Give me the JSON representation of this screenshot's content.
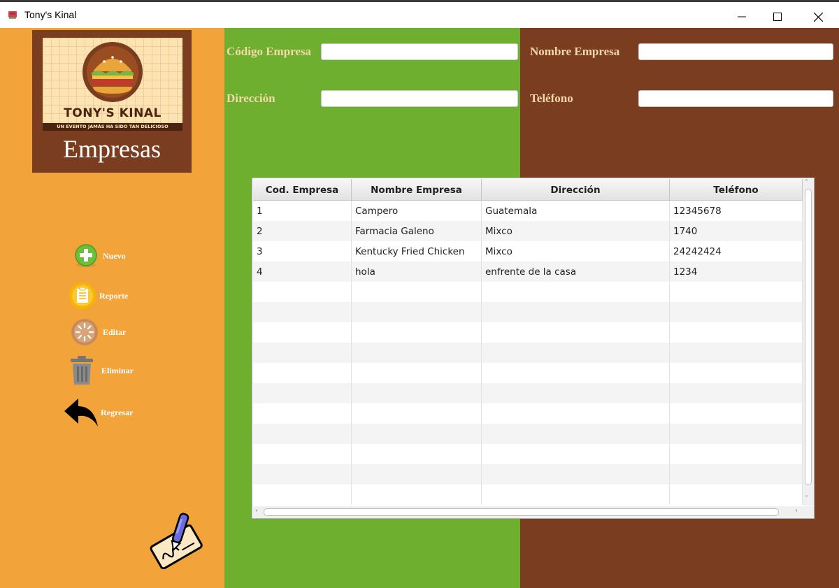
{
  "window": {
    "title": "Tony's Kinal",
    "icon": "app-icon",
    "controls": [
      "minimize-icon",
      "maximize-icon",
      "close-icon"
    ]
  },
  "sidebar": {
    "logo": {
      "brand": "TONY'S KINAL",
      "slogan": "UN EVENTO JAMÁS HA SIDO TAN DELICIOSO"
    },
    "section_title": "Empresas",
    "buttons": [
      {
        "label": "Nuevo",
        "icon": "add-icon"
      },
      {
        "label": "Reporte",
        "icon": "report-icon"
      },
      {
        "label": "Editar",
        "icon": "edit-icon"
      },
      {
        "label": "Eliminar",
        "icon": "trash-icon"
      },
      {
        "label": "Regresar",
        "icon": "back-arrow-icon"
      }
    ],
    "footer_icon": "signature-icon"
  },
  "form": {
    "codigo_label": "Código Empresa",
    "codigo_value": "",
    "nombre_label": "Nombre Empresa",
    "nombre_value": "",
    "direccion_label": "Dirección",
    "direccion_value": "",
    "telefono_label": "Teléfono",
    "telefono_value": ""
  },
  "table": {
    "columns": [
      "Cod. Empresa",
      "Nombre Empresa",
      "Dirección",
      "Teléfono"
    ],
    "rows": [
      [
        "1",
        "Campero",
        "Guatemala",
        "12345678"
      ],
      [
        "2",
        "Farmacia Galeno",
        "Mixco",
        "1740"
      ],
      [
        "3",
        "Kentucky Fried Chicken",
        "Mixco",
        "24242424"
      ],
      [
        "4",
        "hola",
        "enfrente de la casa",
        "1234"
      ]
    ],
    "empty_rows": 11
  },
  "colors": {
    "sidebar": "#F2A33A",
    "green_panel": "#6FAF2F",
    "brown_panel": "#7A3D1F",
    "label_text": "#F6D9A8"
  }
}
